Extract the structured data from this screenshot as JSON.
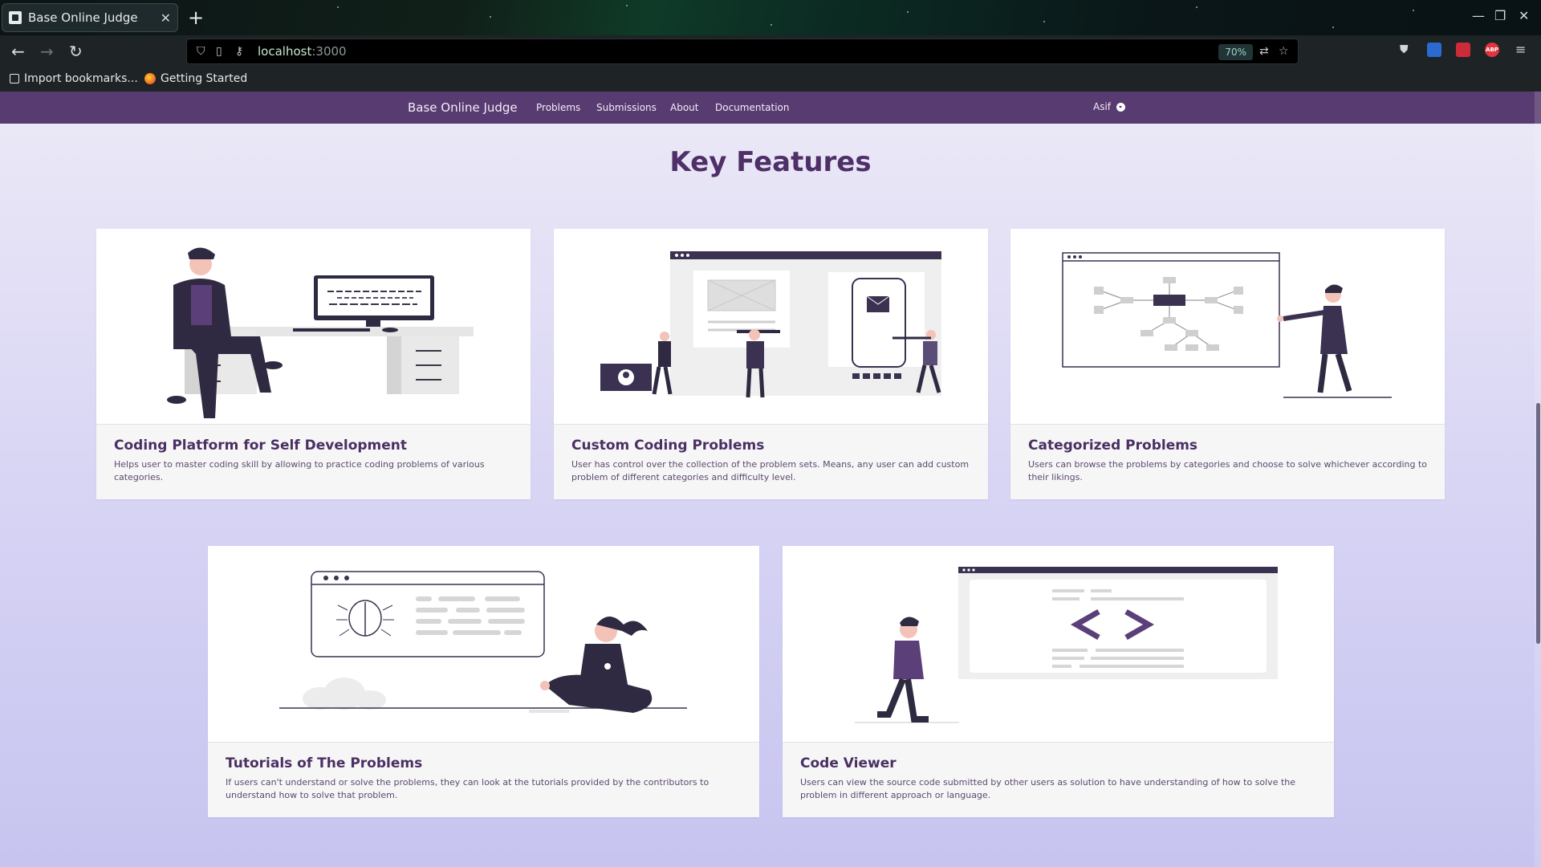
{
  "browser": {
    "tab_title": "Base Online Judge",
    "tab_close": "✕",
    "new_tab": "+",
    "url_host": "localhost",
    "url_port": ":3000",
    "zoom": "70%",
    "window_controls": [
      "—",
      "❐",
      "✕"
    ],
    "bookmarks": [
      {
        "label": "Import bookmarks..."
      },
      {
        "label": "Getting Started"
      }
    ]
  },
  "site": {
    "brand": "Base Online Judge",
    "nav": [
      "Problems",
      "Submissions",
      "About",
      "Documentation"
    ],
    "user": "Asif"
  },
  "section": {
    "title": "Key Features"
  },
  "cards": [
    {
      "title": "Coding Platform for Self Development",
      "text": "Helps user to master coding skill by allowing to practice coding problems of various categories."
    },
    {
      "title": "Custom Coding Problems",
      "text": "User has control over the collection of the problem sets. Means, any user can add custom problem of different categories and difficulty level."
    },
    {
      "title": "Categorized Problems",
      "text": "Users can browse the problems by categories and choose to solve whichever according to their likings."
    },
    {
      "title": "Tutorials of The Problems",
      "text": "If users can't understand or solve the problems, they can look at the tutorials provided by the contributors to understand how to solve that problem."
    },
    {
      "title": "Code Viewer",
      "text": "Users can view the source code submitted by other users as solution to have understanding of how to solve the problem in different approach or language."
    }
  ],
  "colors": {
    "site_nav": "#583b70",
    "accent_purple": "#4e2f67",
    "figure_dark": "#2f2a41"
  }
}
